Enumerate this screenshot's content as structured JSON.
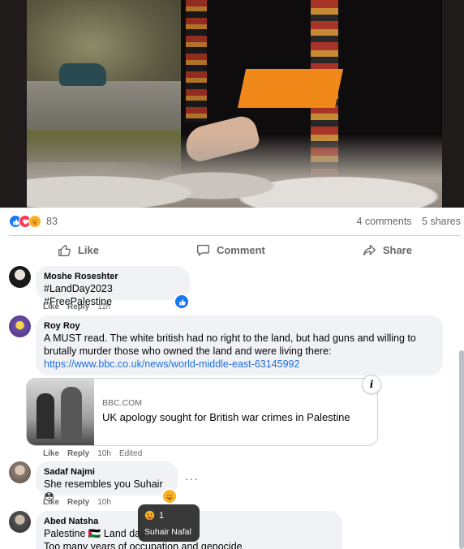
{
  "post": {
    "reactions": {
      "count": "83",
      "icons": [
        "like-icon",
        "love-icon",
        "care-icon"
      ]
    },
    "comments_count": "4 comments",
    "shares_count": "5 shares",
    "actions": {
      "like": "Like",
      "comment": "Comment",
      "share": "Share"
    }
  },
  "comments": [
    {
      "author": "Moshe Roseshter",
      "text": "#LandDay2023 #FreePalestine",
      "like": "Like",
      "reply": "Reply",
      "time": "11h",
      "reaction_icon": "like-icon"
    },
    {
      "author": "Roy Roy",
      "text": "A MUST read. The white british had no right to the land, but had guns and willing to brutally murder those who owned the land and were living there:",
      "link": "https://www.bbc.co.uk/news/world-middle-east-63145992",
      "preview": {
        "source": "BBC.COM",
        "title": "UK apology sought for British war crimes in Palestine"
      },
      "like": "Like",
      "reply": "Reply",
      "time": "10h",
      "edited": "Edited"
    },
    {
      "author": "Sadaf Najmi",
      "text": "She resembles you Suhair😳",
      "like": "Like",
      "reply": "Reply",
      "time": "10h",
      "reaction_icon": "care-icon"
    },
    {
      "author": "Abed Natsha",
      "text_line1": "Palestine 🇵🇸 Land day",
      "text_line2": "Too many years of occupation and genocide"
    }
  ],
  "tooltip": {
    "count": "1",
    "name": "Suhair Nafal"
  },
  "colors": {
    "accent": "#1877f2",
    "link": "#216fdb",
    "muted": "#65676b",
    "bubble": "#f0f2f5"
  }
}
